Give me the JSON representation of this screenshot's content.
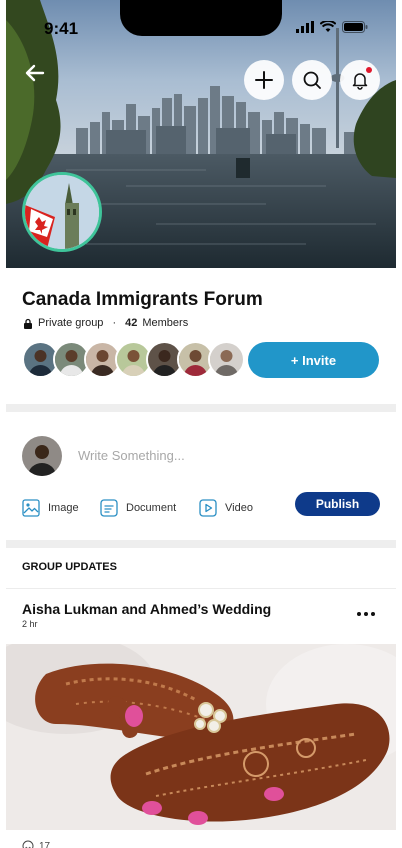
{
  "status_bar": {
    "time": "9:41"
  },
  "header": {
    "back_label": "back",
    "icons": [
      "arrow-left-icon",
      "plus-icon",
      "search-icon",
      "bell-icon"
    ]
  },
  "group": {
    "name": "Canada Immigrants Forum",
    "privacy": "Private group",
    "separator": "·",
    "member_count": "42",
    "member_label": "Members",
    "invite_label": "+ Invite"
  },
  "composer": {
    "placeholder": "Write Something...",
    "attachments": [
      {
        "label": "Image",
        "icon": "image-icon"
      },
      {
        "label": "Document",
        "icon": "document-icon"
      },
      {
        "label": "Video",
        "icon": "video-icon"
      }
    ],
    "publish_label": "Publish"
  },
  "updates": {
    "section_title": "GROUP UPDATES",
    "post": {
      "title": "Aisha Lukman and Ahmed’s Wedding",
      "time": "2 hr",
      "reaction_count": "17"
    }
  },
  "colors": {
    "invite": "#2196c9",
    "publish": "#0e3a8a",
    "avatar_ring": "#3fc49a",
    "notification": "#e0182d"
  }
}
